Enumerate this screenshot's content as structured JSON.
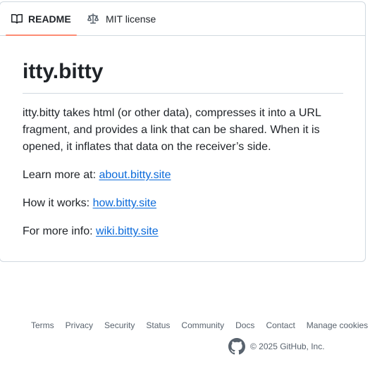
{
  "tabs": {
    "readme_label": "README",
    "readme_icon": "book-icon",
    "license_label": "MIT license",
    "license_icon": "scale-icon"
  },
  "readme": {
    "title": "itty.bitty",
    "description": "itty.bitty takes html (or other data), compresses it into a URL fragment, and provides a link that can be shared. When it is opened, it inflates that data on the receiver’s side.",
    "learn_more_prefix": "Learn more at: ",
    "learn_more_link": "about.bitty.site",
    "how_prefix": "How it works: ",
    "how_link": "how.bitty.site",
    "info_prefix": "For more info: ",
    "info_link": "wiki.bitty.site"
  },
  "footer": {
    "links": [
      "Terms",
      "Privacy",
      "Security",
      "Status",
      "Community",
      "Docs",
      "Contact",
      "Manage cookies"
    ],
    "copyright": "© 2025 GitHub, Inc.",
    "logo_icon": "github-logo-icon"
  },
  "colors": {
    "link": "#0969da",
    "active_tab_underline": "#fd8c73",
    "muted_text": "#59636e",
    "border": "#d1d9e0"
  }
}
